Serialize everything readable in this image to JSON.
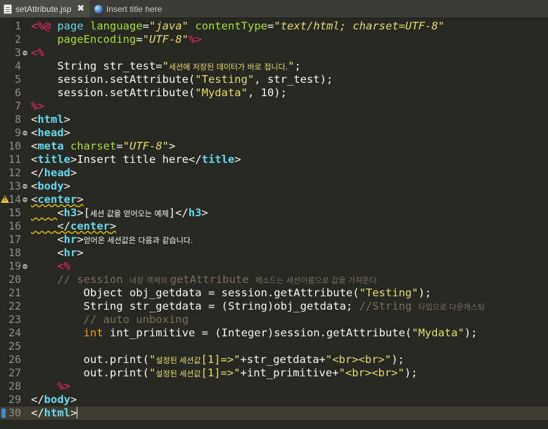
{
  "tabs": [
    {
      "label": "setAttribute.jsp",
      "icon": "file-icon",
      "active": true,
      "close": "✖"
    },
    {
      "label": "Insert title here",
      "icon": "globe-icon",
      "active": false
    }
  ],
  "colors": {
    "background": "#272822",
    "keyword": "#66d9ef",
    "tag": "#f92672",
    "string": "#e6db74",
    "comment": "#75715e",
    "attr": "#a6e22e"
  },
  "lines": {
    "n": [
      "1",
      "2",
      "3",
      "4",
      "5",
      "6",
      "7",
      "8",
      "9",
      "10",
      "11",
      "12",
      "13",
      "14",
      "15",
      "16",
      "17",
      "18",
      "19",
      "20",
      "21",
      "22",
      "23",
      "24",
      "25",
      "26",
      "27",
      "28",
      "29",
      "30"
    ],
    "l1": [
      "<%@",
      "page",
      "language",
      "=",
      "\"java\"",
      "contentType",
      "=",
      "\"text/html; charset=UTF-8\""
    ],
    "l2": [
      "pageEncoding",
      "=",
      "\"UTF-8\"",
      "%>"
    ],
    "l3": [
      "<%"
    ],
    "l4": [
      "String str_test=",
      "\"",
      "세션에 저장된 데이터가 바로 접니다.",
      "\"",
      ";"
    ],
    "l5": [
      "session.setAttribute(",
      "\"Testing\"",
      ", str_test);"
    ],
    "l6": [
      "session.setAttribute(",
      "\"Mydata\"",
      ", ",
      "10",
      ");"
    ],
    "l7": [
      "%>"
    ],
    "l8": [
      "<",
      "html",
      ">"
    ],
    "l9": [
      "<",
      "head",
      ">"
    ],
    "l10": [
      "<",
      "meta",
      "charset",
      "=",
      "\"UTF-8\"",
      ">"
    ],
    "l11": [
      "<",
      "title",
      ">",
      "Insert title here",
      "</",
      "title",
      ">"
    ],
    "l12": [
      "</",
      "head",
      ">"
    ],
    "l13": [
      "<",
      "body",
      ">"
    ],
    "l14": [
      "<",
      "center",
      ">"
    ],
    "l15": [
      "<",
      "h3",
      ">",
      "[",
      "세션 값을 얻어오는 예제",
      "]",
      "</",
      "h3",
      ">"
    ],
    "l16": [
      "</",
      "center",
      ">"
    ],
    "l17": [
      "<",
      "hr",
      ">",
      "얻어온 세션값은 다음과 같습니다."
    ],
    "l18": [
      "<",
      "hr",
      ">"
    ],
    "l19": [
      "<%"
    ],
    "l20": [
      "// session ",
      "내장 객체의 ",
      "getAttribute ",
      "메소드는 세션이름으로 값을 가져온다."
    ],
    "l21": [
      "Object obj_getdata = session.getAttribute(",
      "\"Testing\"",
      ");"
    ],
    "l22": [
      "String str_getdata = (String)obj_getdata; ",
      "//String ",
      "타입으로 다운캐스팅"
    ],
    "l23": [
      "// auto unboxing"
    ],
    "l24": [
      "int",
      " int_primitive = (Integer)session.getAttribute(",
      "\"Mydata\"",
      ");"
    ],
    "l26": [
      "out.print(",
      "\"",
      "설정된 세션값",
      "[1]=>\"",
      "+str_getdata+",
      "\"<br><br>\"",
      ");"
    ],
    "l27": [
      "out.print(",
      "\"",
      "설정된 세션값",
      "[1]=>\"",
      "+int_primitive+",
      "\"<br><br>\"",
      ");"
    ],
    "l28": [
      "%>"
    ],
    "l29": [
      "</",
      "body",
      ">"
    ],
    "l30": [
      "</",
      "html",
      ">"
    ]
  }
}
